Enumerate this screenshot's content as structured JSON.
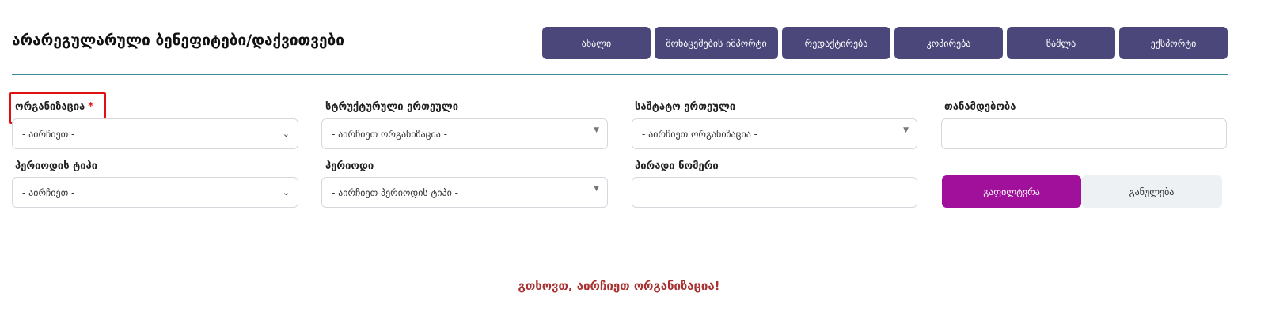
{
  "page": {
    "title": "არარეგულარული ბენეფიტები/დაქვითვები"
  },
  "toolbar": {
    "buttons": [
      {
        "label": "ახალი"
      },
      {
        "label": "მონაცემების იმპორტი"
      },
      {
        "label": "რედაქტირება"
      },
      {
        "label": "კოპირება"
      },
      {
        "label": "წაშლა"
      },
      {
        "label": "ექსპორტი"
      }
    ]
  },
  "filters": {
    "organization": {
      "label": "ორგანიზაცია",
      "required_mark": "*",
      "value": "- აირჩიეთ -"
    },
    "structural_unit": {
      "label": "სტრუქტურული ერთეული",
      "value": "- აირჩიეთ ორგანიზაცია -"
    },
    "staff_unit": {
      "label": "საშტატო ერთეული",
      "value": "- აირჩიეთ ორგანიზაცია -"
    },
    "position": {
      "label": "თანამდებობა",
      "value": ""
    },
    "period_type": {
      "label": "პერიოდის ტიპი",
      "value": "- აირჩიეთ -"
    },
    "period": {
      "label": "პერიოდი",
      "value": "- აირჩიეთ პერიოდის ტიპი -"
    },
    "personal_number": {
      "label": "პირადი ნომერი",
      "value": ""
    },
    "filter_button": "გაფილტვრა",
    "reset_button": "განულება"
  },
  "message": "გთხოვთ, აირჩიეთ ორგანიზაცია!",
  "colors": {
    "toolbar_button": "#4b477a",
    "filter_button": "#a0109a",
    "reset_button": "#eef1f3",
    "divider": "#3a8a9a",
    "message": "#a83232",
    "required": "#e02020",
    "highlight": "#e01010"
  },
  "icons": {
    "select_open": "chevron-down-icon",
    "select_dependent": "caret-down-icon"
  }
}
